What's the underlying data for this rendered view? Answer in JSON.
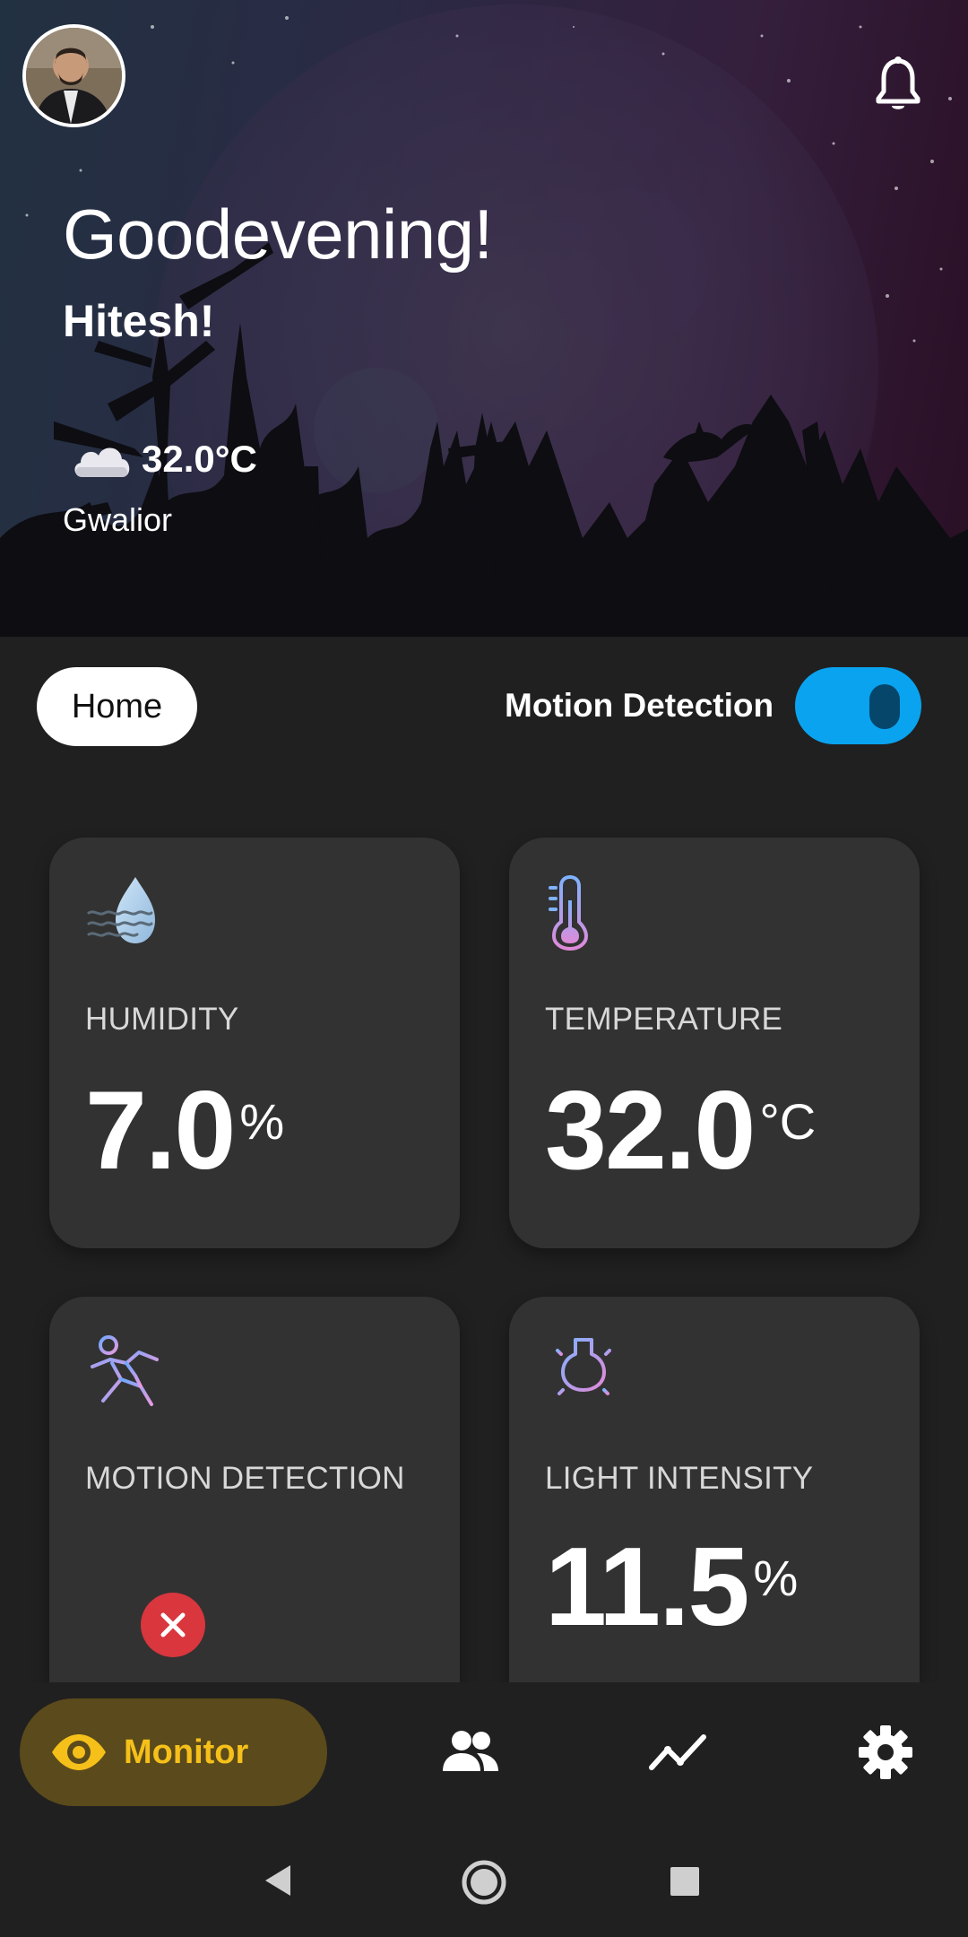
{
  "header": {
    "greeting": "Goodevening!",
    "user_name": "Hitesh!",
    "weather_temp": "32.0°C",
    "city": "Gwalior",
    "weather_icon": "cloud-icon",
    "notification_icon": "bell-icon"
  },
  "controls": {
    "home_label": "Home",
    "motion_toggle_label": "Motion Detection",
    "motion_toggle_on": true,
    "toggle_color": "#0aa3f0"
  },
  "cards": {
    "humidity": {
      "label": "HUMIDITY",
      "value": "7.0",
      "unit": "%",
      "icon": "humidity-icon"
    },
    "temperature": {
      "label": "TEMPERATURE",
      "value": "32.0",
      "unit": "°C",
      "icon": "thermometer-icon"
    },
    "motion": {
      "label": "MOTION DETECTION",
      "status": "not-detected",
      "icon": "running-person-icon",
      "status_color": "#d9363e"
    },
    "light": {
      "label": "LIGHT INTENSITY",
      "value": "11.5",
      "unit": "%",
      "icon": "lightbulb-icon"
    }
  },
  "bottom_nav": {
    "active_label": "Monitor",
    "active_icon": "eye-icon",
    "accent": "#f5c01a",
    "items": [
      "people-icon",
      "trend-icon",
      "gear-icon"
    ]
  }
}
